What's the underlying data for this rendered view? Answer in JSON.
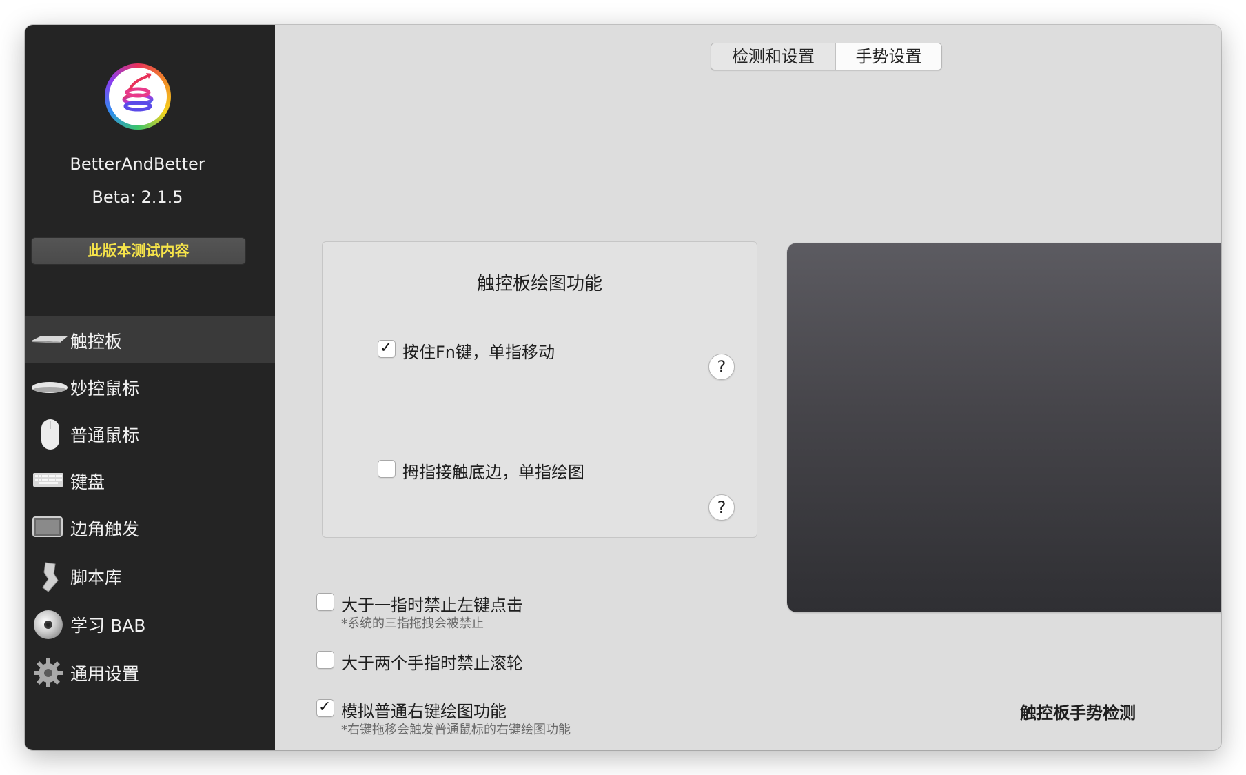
{
  "sidebar": {
    "app_name": "BetterAndBetter",
    "version": "Beta:  2.1.5",
    "beta_button_label": "此版本测试内容",
    "items": [
      {
        "label": "触控板",
        "icon": "trackpad-icon",
        "active": true
      },
      {
        "label": "妙控鼠标",
        "icon": "magic-mouse-icon",
        "active": false
      },
      {
        "label": "普通鼠标",
        "icon": "mouse-icon",
        "active": false
      },
      {
        "label": "键盘",
        "icon": "keyboard-icon",
        "active": false
      },
      {
        "label": "边角触发",
        "icon": "hot-corner-icon",
        "active": false
      },
      {
        "label": "脚本库",
        "icon": "script-icon",
        "active": false
      },
      {
        "label": "学习 BAB",
        "icon": "dvd-icon",
        "active": false
      },
      {
        "label": "通用设置",
        "icon": "gear-icon",
        "active": false
      }
    ]
  },
  "tabs": {
    "detect_settings": "检测和设置",
    "gesture_settings": "手势设置",
    "selected": "手势设置"
  },
  "drawing": {
    "title": "触控板绘图功能",
    "option1": {
      "label": "按住Fn键，单指移动",
      "checked": true
    },
    "option2": {
      "label": "拇指接触底边，单指绘图",
      "checked": false
    },
    "help_label": "?"
  },
  "options": {
    "disable_left_click": {
      "label": "大于一指时禁止左键点击",
      "note": "*系统的三指拖拽会被禁止",
      "checked": false
    },
    "disable_scroll": {
      "label": "大于两个手指时禁止滚轮",
      "checked": false
    },
    "simulate_right_drawing": {
      "label": "模拟普通右键绘图功能",
      "note": "*右键拖移会触发普通鼠标的右键绘图功能",
      "checked": true
    }
  },
  "trackpad_detect_label": "触控板手势检测",
  "check_mark": "✓",
  "colors": {
    "sidebar_bg": "#242424",
    "beta_text": "#f5e34a",
    "main_bg": "#dddddd"
  }
}
